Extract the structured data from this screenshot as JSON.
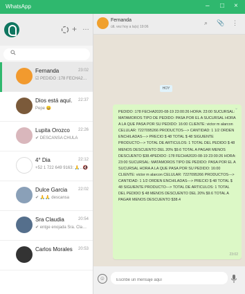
{
  "window": {
    "title": "WhatsApp",
    "controls": [
      "–",
      "□",
      "×"
    ]
  },
  "sidebar": {
    "header_icons": [
      "+",
      "…"
    ],
    "search_icon": "magnifier",
    "chats": [
      {
        "name": "Fernanda",
        "snip": "☑ PEDIDO :178 FECHA2020-08-19...",
        "time": "23:02",
        "avatar_color": "#f29a2e",
        "active": true
      },
      {
        "name": "Dios está aquí.",
        "snip": "Pepe 😀",
        "time": "22:37",
        "avatar_color": "#7b5a3a"
      },
      {
        "name": "Lupita Orozco",
        "snip": "✔ DESCANSA CHULA",
        "time": "22:26",
        "avatar_color": "#d9b7bc"
      },
      {
        "name": "4° Dia",
        "snip": "+52 1 722 649 9163: 🙏🙏🙏",
        "time": "22:12",
        "avatar_color": "#ffffff"
      },
      {
        "name": "Dulce Garcia",
        "snip": "✔ 🙏🙏 descansa",
        "time": "22:02",
        "avatar_color": "#8aa0b8"
      },
      {
        "name": "Sra Claudia",
        "snip": "✔ entge enojada Sra. Clau soy Vic",
        "time": "20:54",
        "avatar_color": "#556f8c"
      },
      {
        "name": "Carlos Morales",
        "snip": "",
        "time": "20:53",
        "avatar_color": "#333333"
      }
    ]
  },
  "conversation": {
    "contact": "Fernanda",
    "status": "últ. vez hoy a la(s) 19:06",
    "header_icons": [
      "⌕",
      "📎",
      "⋮"
    ],
    "date_pill": "HOY",
    "message": "PEDIDO :178 FECHA2020-08-19 23:00:26 HORA: 23:00 SUCURSAL: MATAMOROS TIPO DE PEDIDO: PASA POR EL A SUCURSAL HORA A LA QUE PASA POR SU PEDIDO: 16:00 CLIENTE: victor m alarcon CELULAR: 7227095266 PRODUCTOS---> CANTIDAD: 1 1/2 ORDEN ENCHILADAS---> PRECIO $ 48 TOTAL $ 48 SIGUIENTE PRODUCTO---> TOTAL DE ARTICULOS: 1 TOTAL DEL PEDIDO $ 48 MENOS DESCUENTO DEL 20% $9.6 TOTAL A PAGAR MENOS DESCUENTO $38.4PEDIDO :178 FECHA2020-08-19 23:00:26 HORA: 23:00 SUCURSAL: MATAMOROS TIPO DE PEDIDO: PASA POR EL A SUCURSAL HORA A LA QUE PASA POR SU PEDIDO: 16:00 CLIENTE: victor m alarcon CELULAR: 7227095266 PRODUCTOS---> CANTIDAD: 1 1/2 ORDEN ENCHILADAS---> PRECIO $ 48 TOTAL $ 48 SIGUIENTE PRODUCTO---> TOTAL DE ARTICULOS: 1 TOTAL DEL PEDIDO $ 48 MENOS DESCUENTO DEL 20% $9.6 TOTAL A PAGAR MENOS DESCUENTO $38.4",
    "message_time": "23:02",
    "compose_placeholder": "Escribe un mensaje aquí"
  }
}
